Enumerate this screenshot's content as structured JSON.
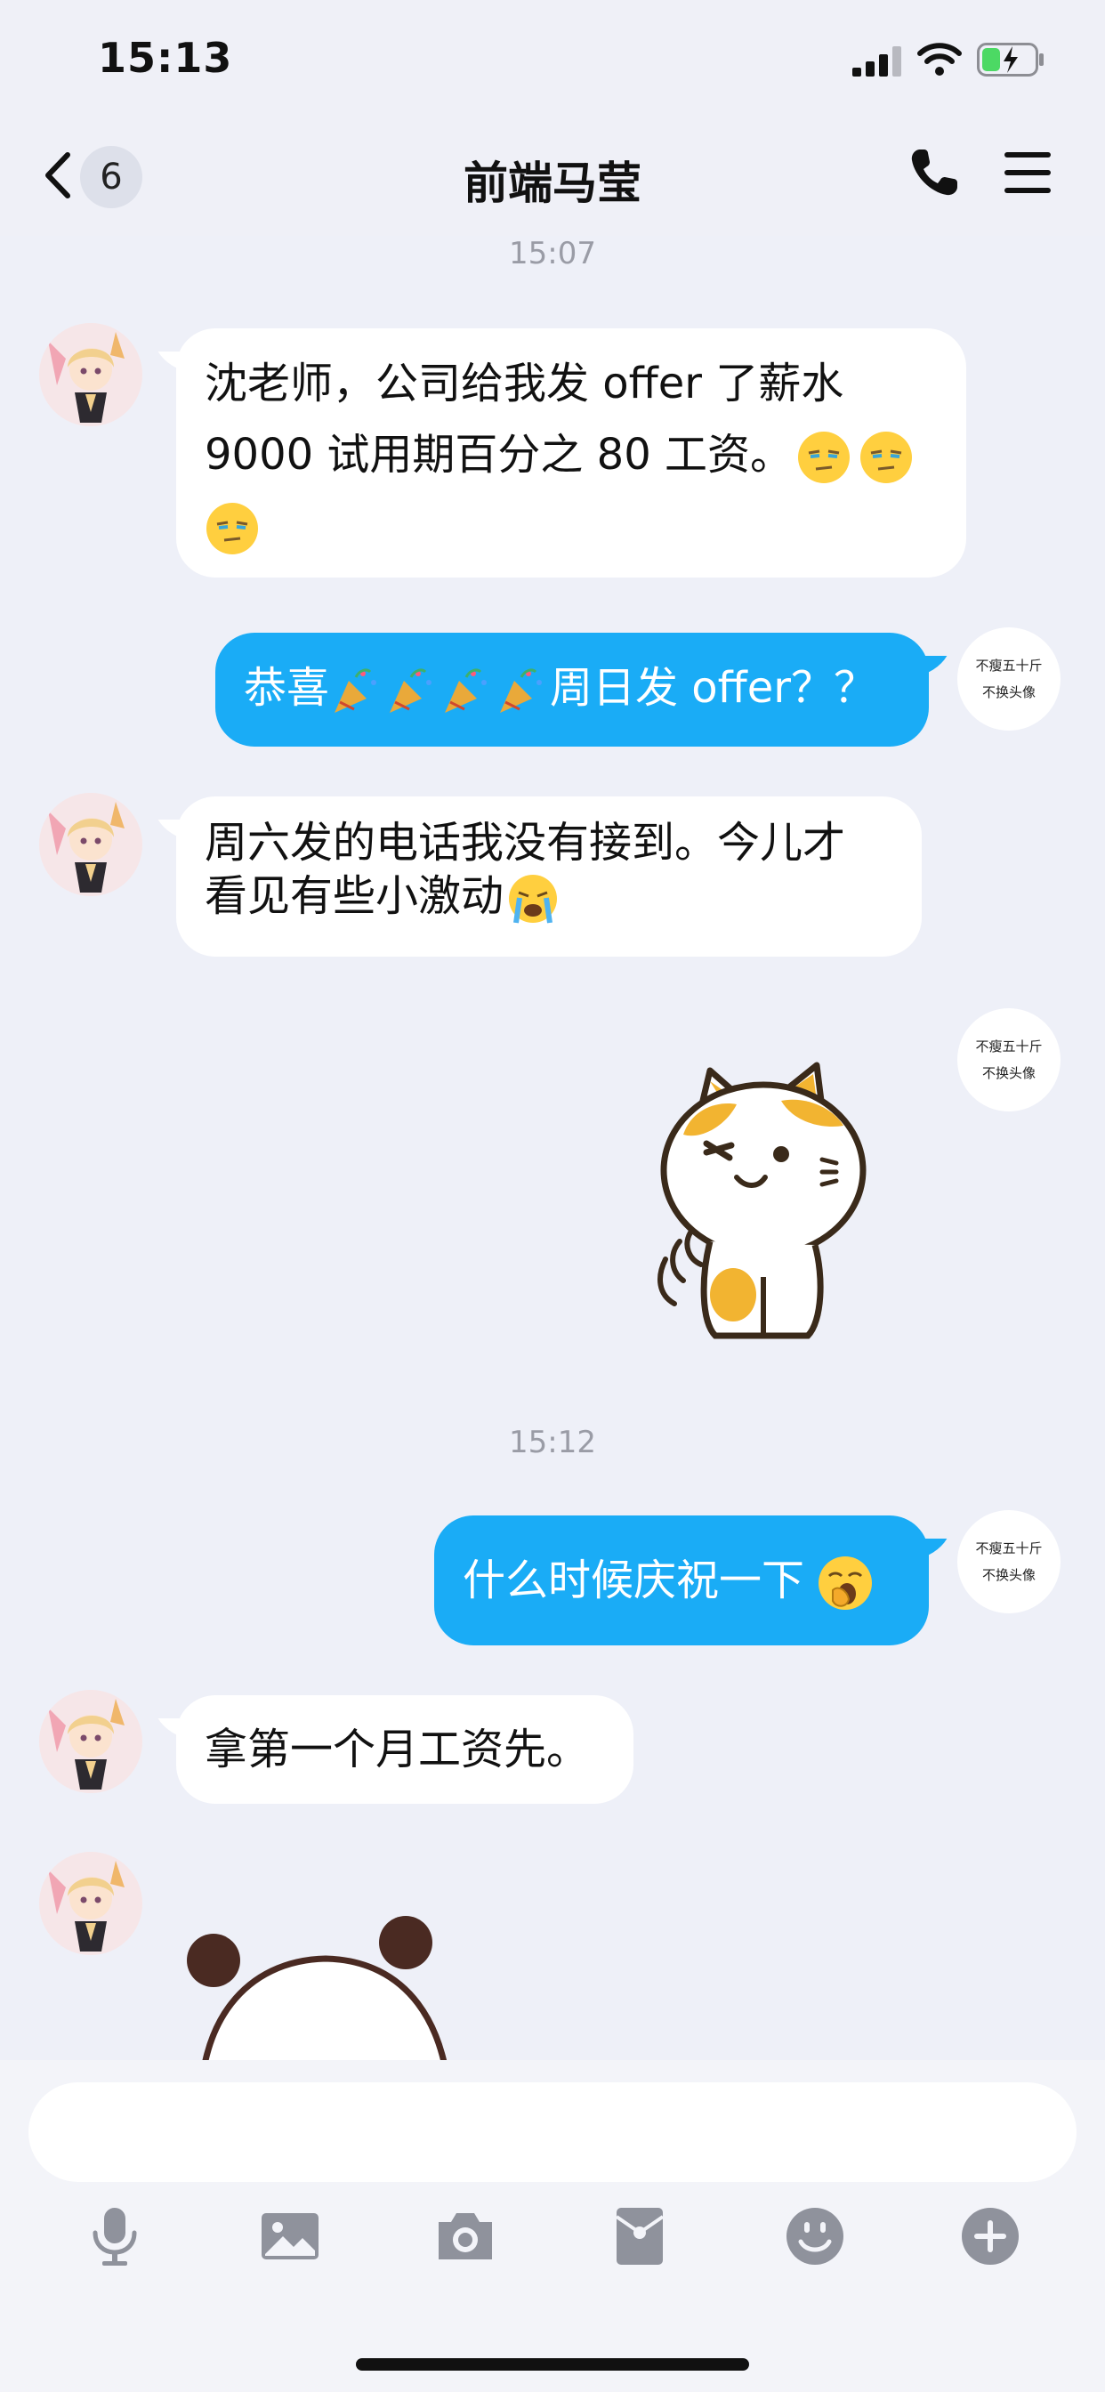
{
  "status_bar": {
    "time": "15:13"
  },
  "nav": {
    "unread_count": "6",
    "title": "前端马莹"
  },
  "chat": {
    "timestamps": [
      "15:07",
      "15:12"
    ],
    "messages": [
      {
        "sender": "contact",
        "line1": "沈老师，公司给我发 offer 了薪水",
        "line2": "9000 试用期百分之 80 工资。"
      },
      {
        "sender": "me",
        "prefix": "恭喜",
        "suffix": "周日发 offer？？"
      },
      {
        "sender": "contact",
        "line1": "周六发的电话我没有接到。今儿才",
        "line2": "看见有些小激动"
      },
      {
        "sender": "me",
        "type": "sticker"
      },
      {
        "sender": "me",
        "text": "什么时候庆祝一下"
      },
      {
        "sender": "contact",
        "text": "拿第一个月工资先。"
      },
      {
        "sender": "contact",
        "type": "sticker"
      }
    ],
    "my_avatar": {
      "line1": "不瘦五十斤",
      "line2": "不换头像"
    }
  },
  "input": {
    "placeholder": ""
  },
  "toolbar": [
    "microphone-icon",
    "image-icon",
    "camera-icon",
    "red-packet-icon",
    "emoji-icon",
    "plus-icon"
  ],
  "colors": {
    "outgoing_bubble": "#1aacf6",
    "incoming_bubble": "#ffffff",
    "background": "#eef0f8"
  }
}
